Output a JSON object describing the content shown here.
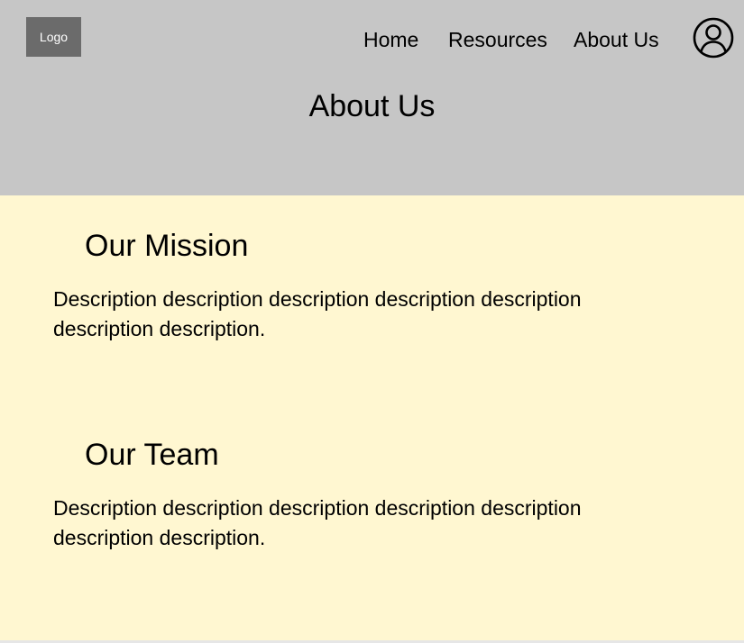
{
  "header": {
    "logo_label": "Logo",
    "nav": {
      "home": "Home",
      "resources": "Resources",
      "about": "About Us"
    },
    "profile_icon": "user-circle-icon",
    "title": "About Us"
  },
  "sections": {
    "mission": {
      "heading": "Our Mission",
      "body": "Description description description description description description description."
    },
    "team": {
      "heading": "Our Team",
      "body": "Description description description description description description description."
    }
  },
  "colors": {
    "header_bg": "#c6c6c6",
    "logo_bg": "#6b6b6b",
    "content_bg": "#fff7d1"
  }
}
